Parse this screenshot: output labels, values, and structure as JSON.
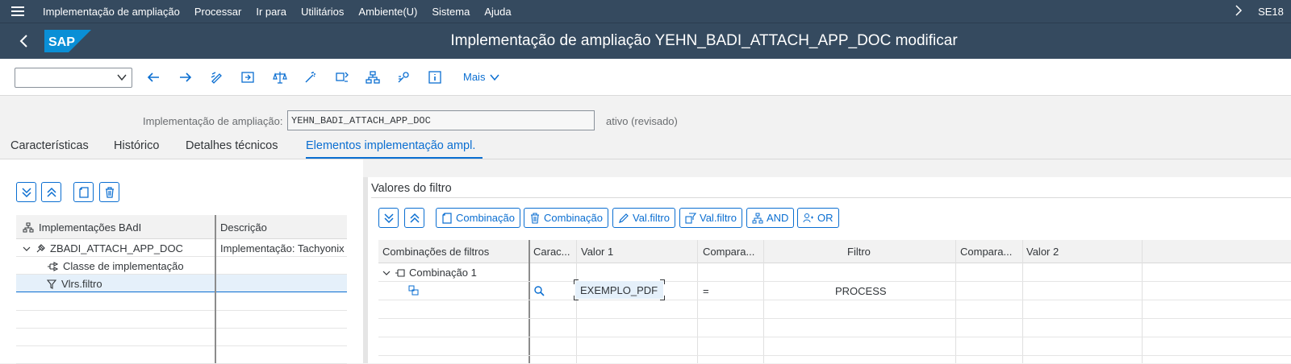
{
  "menubar": {
    "items": [
      "Implementação de ampliação",
      "Processar",
      "Ir para",
      "Utilitários",
      "Ambiente(U)",
      "Sistema",
      "Ajuda"
    ],
    "tcode": "SE18"
  },
  "titlebar": {
    "logo": "SAP",
    "title": "Implementação de ampliação YEHN_BADI_ATTACH_APP_DOC modificar"
  },
  "toolbar": {
    "okcode_value": "",
    "icons": [
      "back-arrow-icon",
      "forward-arrow-icon",
      "display-change-icon",
      "activate-icon",
      "check-icon",
      "magic-wand-icon",
      "object-list-icon",
      "hierarchy-icon",
      "settings-icon",
      "info-icon"
    ],
    "more_label": "Mais"
  },
  "header_field": {
    "label": "Implementação de ampliação:",
    "value": "YEHN_BADI_ATTACH_APP_DOC",
    "status": "ativo (revisado)"
  },
  "tabs": [
    "Características",
    "Histórico",
    "Detalhes técnicos",
    "Elementos implementação ampl."
  ],
  "active_tab": 3,
  "left_tree": {
    "columns": [
      "Implementações BAdI",
      "Descrição"
    ],
    "rows": [
      {
        "label": "ZBADI_ATTACH_APP_DOC",
        "desc": "Implementação: Tachyonix"
      },
      {
        "label": "Classe de implementação",
        "desc": ""
      },
      {
        "label": "Vlrs.filtro",
        "desc": ""
      }
    ]
  },
  "right_panel": {
    "title": "Valores do filtro",
    "buttons": [
      "Combinação",
      "Combinação",
      "Val.filtro",
      "Val.filtro",
      "AND",
      "OR"
    ],
    "columns": [
      "Combinações de filtros",
      "Carac...",
      "Valor 1",
      "Compara...",
      "Filtro",
      "Compara...",
      "Valor 2"
    ],
    "combination_label": "Combinação 1",
    "row": {
      "valor1": "EXEMPLO_PDF",
      "comparator": "=",
      "filtro": "PROCESS"
    }
  },
  "colors": {
    "shell": "#354a5f",
    "accent": "#0a6ed1",
    "selection": "#e5f0fa"
  }
}
